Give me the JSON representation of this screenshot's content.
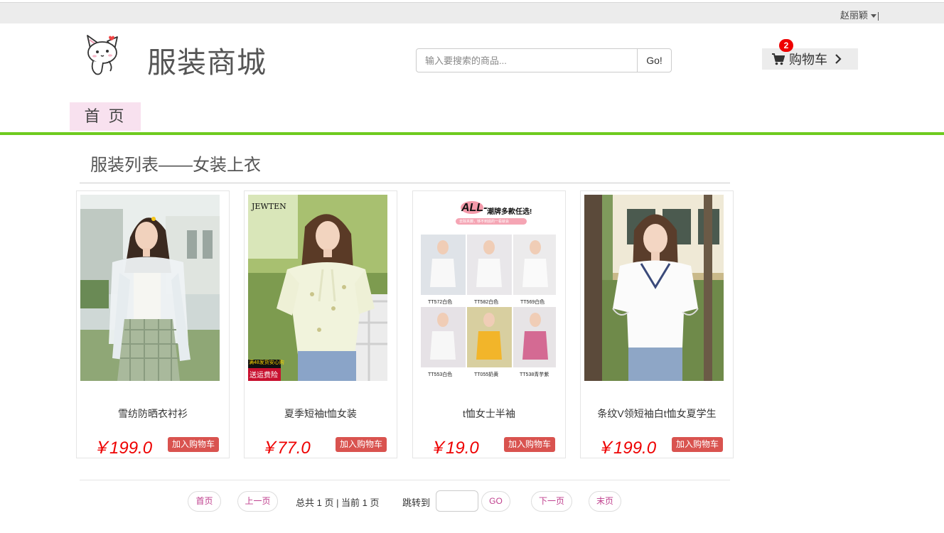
{
  "topbar": {
    "username": "赵丽颖"
  },
  "header": {
    "site_title": "服装商城",
    "search": {
      "placeholder": "输入要搜索的商品...",
      "value": "",
      "button_label": "Go!"
    },
    "cart": {
      "label": "购物车",
      "count": "2"
    }
  },
  "nav": {
    "home_label": "首 页"
  },
  "section": {
    "title": "服装列表——女装上衣"
  },
  "products": [
    {
      "name": "雪纺防晒衣衬衫",
      "price": "￥199.0",
      "add_label": "加入购物车"
    },
    {
      "name": "夏季短袖t恤女装",
      "price": "￥77.0",
      "add_label": "加入购物车",
      "image_text": {
        "brand": "JEWTEN",
        "tag1": "满48发货安心购",
        "tag2": "送运费险"
      }
    },
    {
      "name": "t恤女士半袖",
      "price": "￥19.0",
      "add_label": "加入购物车",
      "image_text": {
        "badge": "ALL-",
        "headline": "潮牌多款任选!",
        "subline": "去除夹脚，够不到底的一看就会",
        "codes": [
          "TT572白色",
          "TT582白色",
          "TT569白色",
          "TT553白色",
          "TT055奶黄",
          "TT538青芋紫"
        ]
      }
    },
    {
      "name": "条纹V领短袖白t恤女夏学生",
      "price": "￥199.0",
      "add_label": "加入购物车"
    }
  ],
  "pagination": {
    "first": "首页",
    "prev": "上一页",
    "info": "总共 1 页 | 当前 1 页",
    "jump_label": "跳转到",
    "go": "GO",
    "next": "下一页",
    "last": "末页"
  },
  "colors": {
    "accent_green": "#6ecb1f",
    "price_red": "#e00000",
    "button_red": "#d9534f",
    "nav_pink": "#f8e1ef",
    "pager_text": "#c0408e"
  }
}
